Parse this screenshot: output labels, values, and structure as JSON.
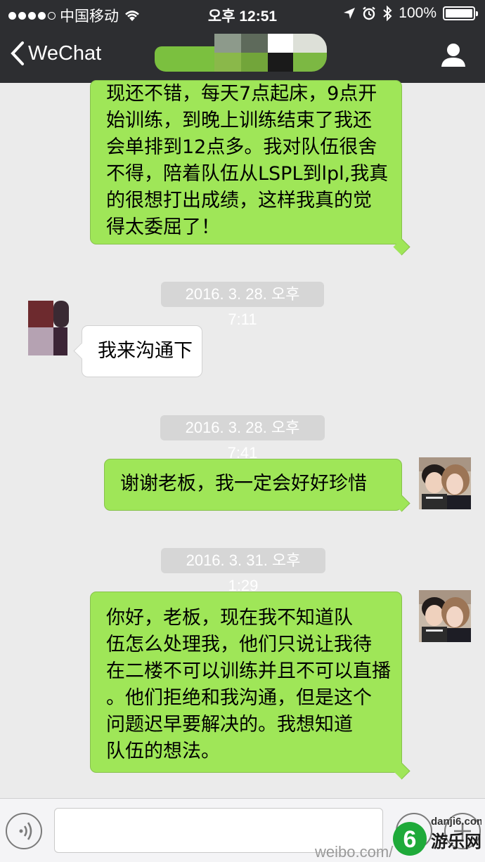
{
  "status_bar": {
    "carrier": "中国移动",
    "time": "오후 12:51",
    "battery_percent": "100%"
  },
  "nav": {
    "back_label": "WeChat",
    "chat_title": ""
  },
  "messages": [
    {
      "type": "outgoing",
      "lines": [
        "现还不错，每天7点起床，9点开",
        "始训练，到晚上训练结束了我还",
        "会单排到12点多。我对队伍很舍",
        "不得，陪着队伍从LSPL到lpl,我真",
        "的很想打出成绩，这样我真的觉",
        "得太委屈了！"
      ]
    },
    {
      "type": "timestamp",
      "text": "2016. 3. 28. 오후 7:11"
    },
    {
      "type": "incoming",
      "lines": [
        "我来沟通下"
      ]
    },
    {
      "type": "timestamp",
      "text": "2016. 3. 28. 오후 7:41"
    },
    {
      "type": "outgoing",
      "lines": [
        "谢谢老板，我一定会好好珍惜"
      ]
    },
    {
      "type": "timestamp",
      "text": "2016. 3. 31. 오후 1:29"
    },
    {
      "type": "outgoing",
      "lines": [
        "你好，老板，现在我不知道队",
        "伍怎么处理我，他们只说让我待",
        "在二楼不可以训练并且不可以直播",
        "。他们拒绝和我沟通，但是这个",
        "问题迟早要解决的。我想知道",
        "队伍的想法。"
      ]
    }
  ],
  "input": {
    "placeholder": ""
  },
  "watermark": {
    "weibo": "weibo.com/",
    "site_number": "6",
    "site_name": "游乐网",
    "site_url": "danji6.com"
  },
  "colors": {
    "header_bg": "#2d2e31",
    "chat_bg": "#ebebeb",
    "outgoing_bubble": "#9fe658",
    "incoming_bubble": "#ffffff",
    "timestamp_bg": "#d6d6d6"
  },
  "icons": [
    "signal-icon",
    "wifi-icon",
    "location-icon",
    "alarm-icon",
    "bluetooth-icon",
    "battery-icon",
    "back-chevron-icon",
    "profile-icon",
    "voice-icon",
    "emoji-icon",
    "plus-icon"
  ]
}
